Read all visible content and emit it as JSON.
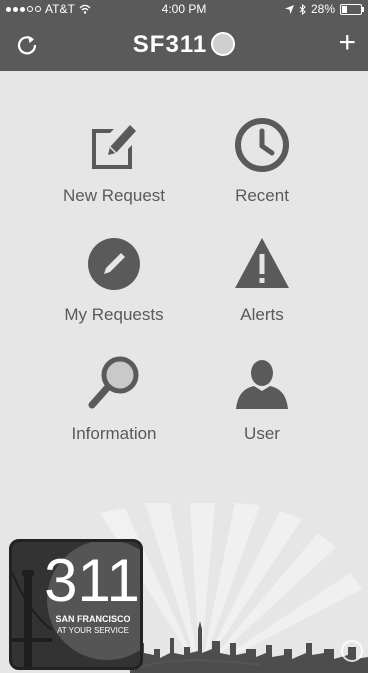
{
  "status": {
    "carrier": "AT&T",
    "time": "4:00 PM",
    "battery": "28%",
    "battery_level": 0.28
  },
  "nav": {
    "title": "SF311",
    "plus": "+"
  },
  "tiles": [
    {
      "label": "New Request"
    },
    {
      "label": "Recent"
    },
    {
      "label": "My Requests"
    },
    {
      "label": "Alerts"
    },
    {
      "label": "Information"
    },
    {
      "label": "User"
    }
  ],
  "logo": {
    "number": "311",
    "line1": "SAN FRANCISCO",
    "line2": "AT YOUR SERVICE"
  },
  "colors": {
    "bar": "#5a5a5a",
    "icon": "#5a5a5a",
    "bg": "#e6e6e6"
  }
}
